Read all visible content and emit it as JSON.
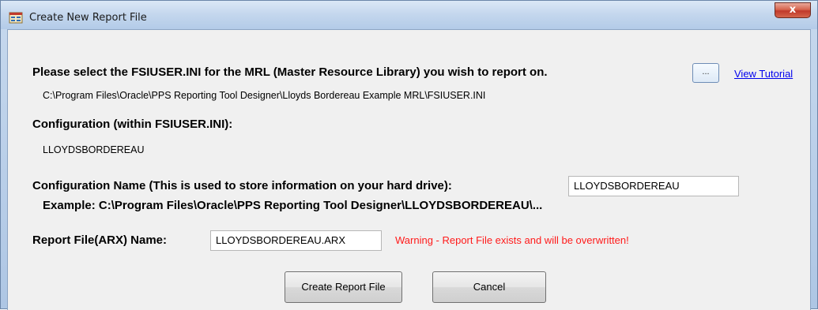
{
  "window": {
    "title": "Create New Report File",
    "close_glyph": "x",
    "icon": "report-file-icon"
  },
  "mrl": {
    "prompt": "Please select the FSIUSER.INI for the MRL (Master Resource Library) you wish to report on.",
    "browse_label": "...",
    "tutorial_link": "View Tutorial",
    "path": "C:\\Program Files\\Oracle\\PPS Reporting Tool Designer\\Lloyds Bordereau Example MRL\\FSIUSER.INI"
  },
  "configuration": {
    "label": "Configuration (within FSIUSER.INI):",
    "value": "LLOYDSBORDEREAU"
  },
  "config_name": {
    "label": "Configuration Name (This is used to store information on your hard drive):",
    "value": "LLOYDSBORDEREAU",
    "example": "Example: C:\\Program Files\\Oracle\\PPS Reporting Tool Designer\\LLOYDSBORDEREAU\\..."
  },
  "report_file": {
    "label": "Report File(ARX) Name:",
    "value": "LLOYDSBORDEREAU.ARX",
    "warning": "Warning - Report File exists and will be overwritten!"
  },
  "buttons": {
    "create": "Create Report File",
    "cancel": "Cancel"
  },
  "colors": {
    "warning": "#ff1a1a",
    "link": "#0000ee",
    "close_button": "#c0392b"
  }
}
